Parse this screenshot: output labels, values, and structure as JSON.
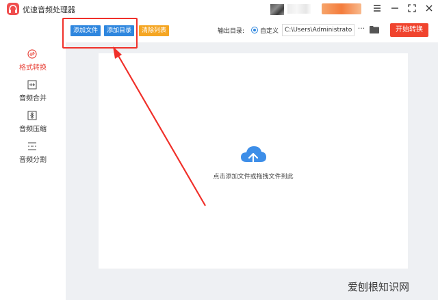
{
  "app": {
    "title": "优速音频处理器"
  },
  "sidebar": {
    "items": [
      {
        "label": "格式转换",
        "active": true,
        "icon": "format-convert-icon"
      },
      {
        "label": "音频合并",
        "active": false,
        "icon": "merge-icon"
      },
      {
        "label": "音频压缩",
        "active": false,
        "icon": "compress-icon"
      },
      {
        "label": "音频分割",
        "active": false,
        "icon": "split-icon"
      }
    ]
  },
  "toolbar": {
    "add_file": "添加文件",
    "add_folder": "添加目录",
    "clear_list": "清除列表",
    "output_label": "输出目录:",
    "radio_label": "自定义",
    "output_path": "C:\\Users\\Administrator\\",
    "more": "···",
    "start": "开始转换"
  },
  "dropzone": {
    "hint": "点击添加文件或拖拽文件到此"
  },
  "watermark": "爱刨根知识网",
  "colors": {
    "accent": "#f0442e",
    "primary": "#2e86de",
    "annotation": "#f0302a"
  }
}
